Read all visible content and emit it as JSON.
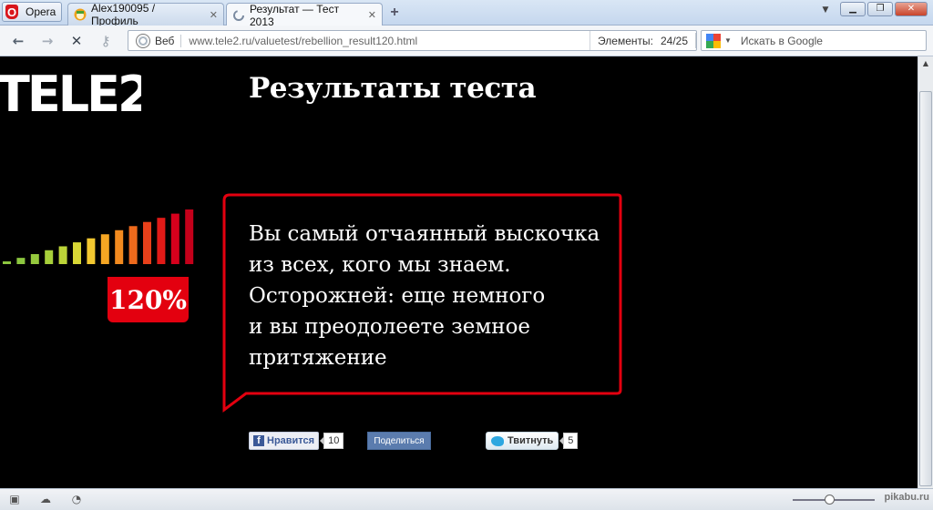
{
  "browser": {
    "menu_label": "Opera",
    "tabs": [
      {
        "label": "Alex190095 / Профиль",
        "active": false
      },
      {
        "label": "Результат — Тест 2013",
        "active": true
      }
    ],
    "address": {
      "scope_label": "Веб",
      "url": "www.tele2.ru/valuetest/rebellion_result120.html",
      "elements_label": "Элементы:",
      "elements_count": "24/25"
    },
    "search": {
      "placeholder": "Искать в Google"
    }
  },
  "page": {
    "logo_text": "TELE2",
    "title": "Результаты теста",
    "percent": "120%",
    "message_lines": [
      "Вы самый отчаянный выскочка",
      "из всех, кого мы знаем.",
      "Осторожней: еще немного",
      "и вы преодолеете земное",
      "притяжение"
    ],
    "social": {
      "like_label": "Нравится",
      "like_count": "10",
      "share_label": "Поделиться",
      "tweet_label": "Твитнуть",
      "tweet_count": "5"
    },
    "meter_bar_colors": [
      "#8cc63f",
      "#8cc63f",
      "#95c93d",
      "#a7cf3a",
      "#bcd438",
      "#d8d735",
      "#f2c830",
      "#f5a623",
      "#f28a1f",
      "#ee6a1c",
      "#e8401a",
      "#e11a17",
      "#d6001c",
      "#c4001a"
    ],
    "accent_color": "#e3000f"
  },
  "statusbar": {
    "watermark": "pikabu.ru"
  }
}
